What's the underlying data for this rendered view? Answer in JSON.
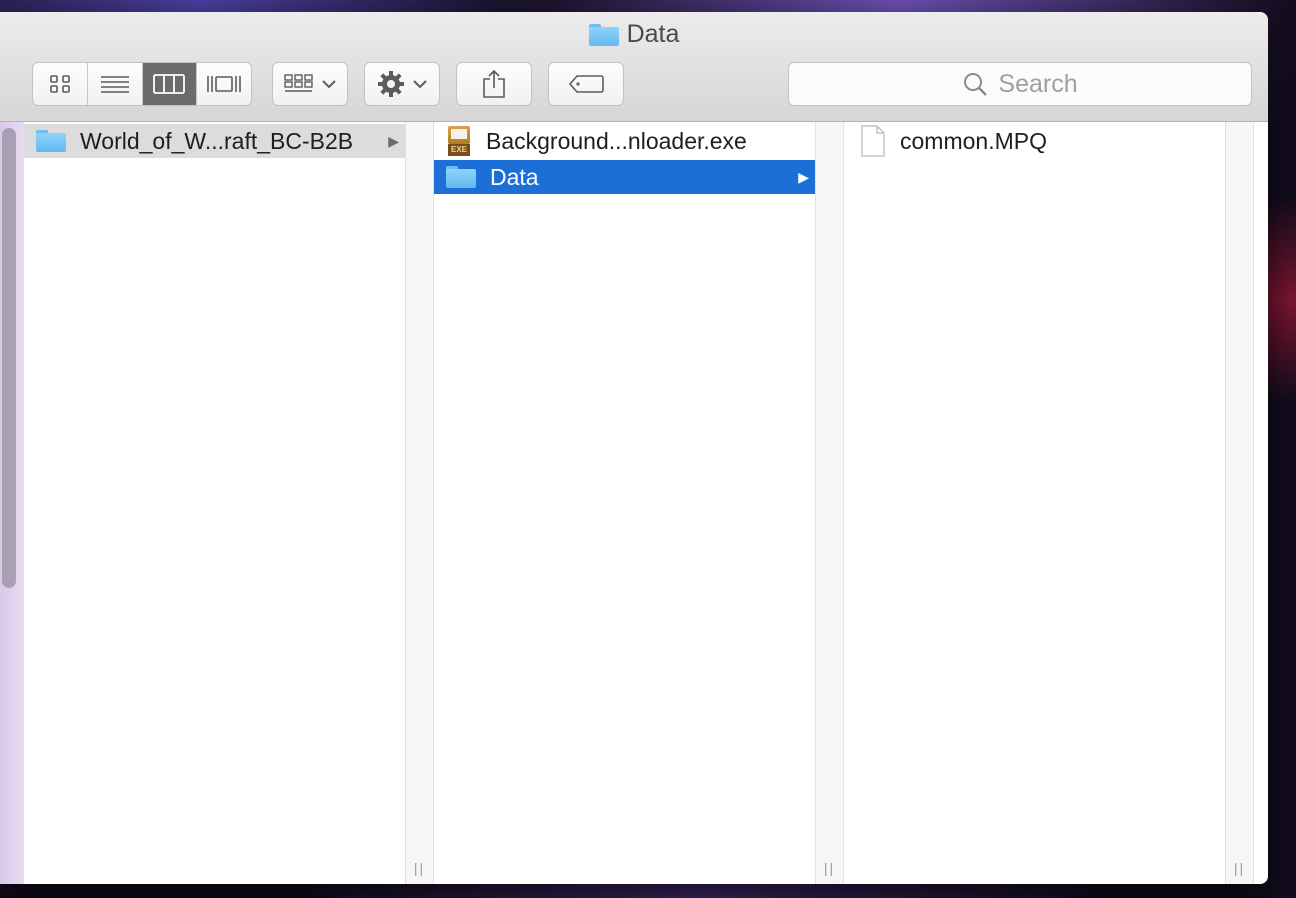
{
  "window": {
    "title": "Data"
  },
  "toolbar": {
    "view_buttons": [
      "icon-view-icon",
      "list-view-icon",
      "column-view-icon",
      "cover-flow-icon"
    ],
    "active_view": "column-view-icon"
  },
  "search": {
    "placeholder": "Search"
  },
  "columns": [
    {
      "items": [
        {
          "name": "World_of_W...raft_BC-B2B",
          "icon": "folder-icon",
          "state": "parent-selected",
          "has_children": true
        }
      ]
    },
    {
      "items": [
        {
          "name": "Background...nloader.exe",
          "icon": "exe-icon",
          "state": "normal",
          "has_children": false
        },
        {
          "name": "Data",
          "icon": "folder-icon",
          "state": "selected",
          "has_children": true
        }
      ]
    },
    {
      "items": [
        {
          "name": "common.MPQ",
          "icon": "document-icon",
          "state": "normal",
          "has_children": false
        }
      ]
    }
  ],
  "colors": {
    "selection": "#1d6fd8",
    "folder": "#7cc7f6",
    "toolbar": "#e0e0e0"
  },
  "resize_handle": "||"
}
